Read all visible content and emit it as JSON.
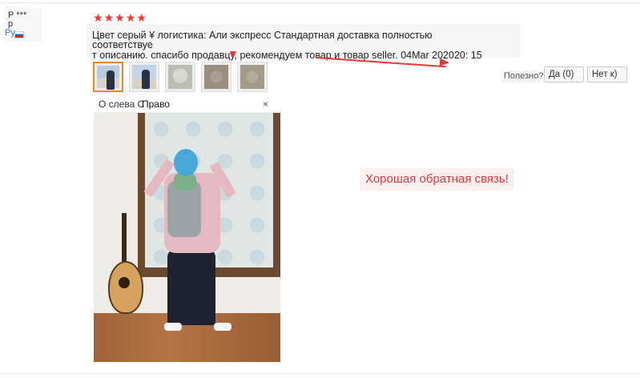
{
  "user": {
    "name": "Р ***\nр",
    "country": "Ру"
  },
  "rating": {
    "stars": 5,
    "star_glyph": "★",
    "color": "#f5342e"
  },
  "review": {
    "line1": "Цвет серый ¥ логистика: Али экспресс Стандартная доставка полностью",
    "line2": "соответствуе",
    "line3": "т описанию. спасибо продавцу, рекомендуем товар и товар seller. 04Mar 202020: 15"
  },
  "helpful": {
    "label": "Полезно?",
    "yes_label": "Да (0)",
    "no_label": "Нет к)"
  },
  "viewer": {
    "nav_left": "О слева С",
    "nav_right": "Право",
    "close": "×"
  },
  "thumbnails": [
    {
      "name": "thumb-1",
      "active": true
    },
    {
      "name": "thumb-2",
      "active": false
    },
    {
      "name": "thumb-3",
      "active": false
    },
    {
      "name": "thumb-4",
      "active": false
    },
    {
      "name": "thumb-5",
      "active": false
    }
  ],
  "feedback_badge": "Хорошая обратная связь!",
  "colors": {
    "accent_red": "#e0393e",
    "active_thumb_border": "#e08a2a",
    "link_blue": "#2a7fd0"
  }
}
